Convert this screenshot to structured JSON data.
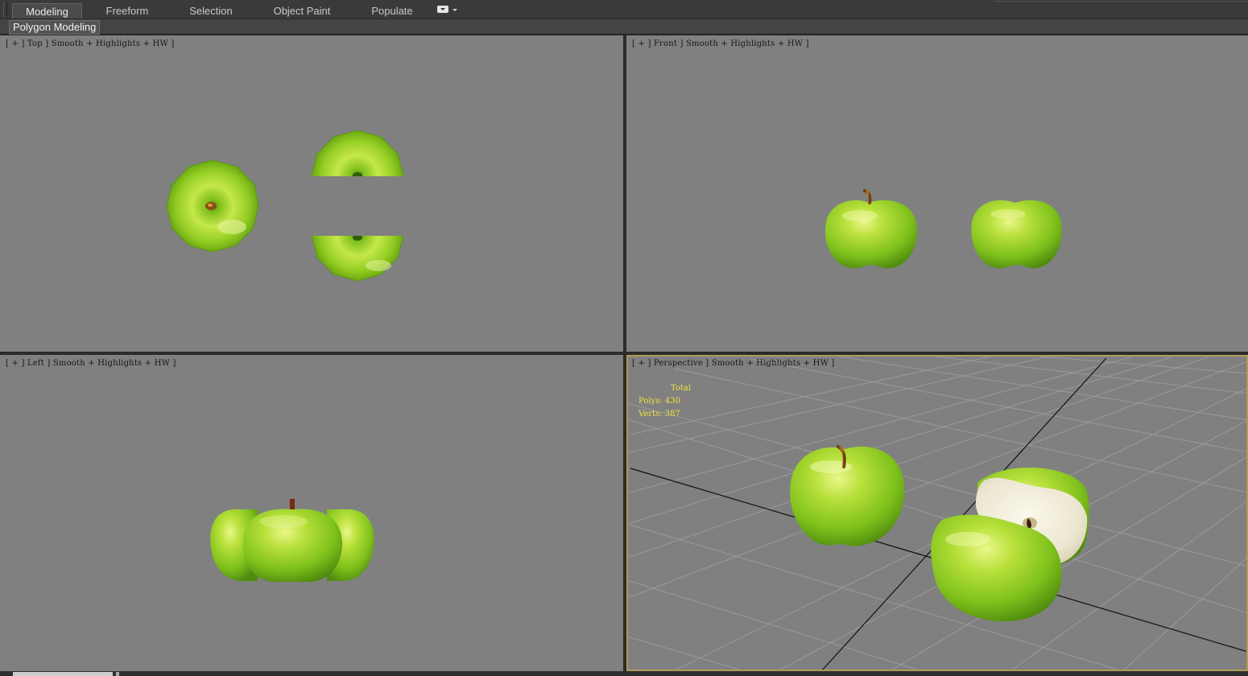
{
  "ribbon": {
    "tabs": [
      {
        "label": "Modeling",
        "active": true
      },
      {
        "label": "Freeform",
        "active": false
      },
      {
        "label": "Selection",
        "active": false
      },
      {
        "label": "Object Paint",
        "active": false
      },
      {
        "label": "Populate",
        "active": false
      }
    ],
    "options_icon": "ribbon-options-icon",
    "panel_label": "Polygon Modeling"
  },
  "viewports": {
    "top": {
      "label": "[ + ] Top ] Smooth + Highlights + HW ]"
    },
    "front": {
      "label": "[ + ] Front ] Smooth + Highlights + HW ]"
    },
    "left": {
      "label": "[ + ] Left ] Smooth + Highlights + HW ]"
    },
    "perspective": {
      "label": "[ + ] Perspective ] Smooth + Highlights + HW ]",
      "active": true,
      "stats": {
        "title": "Total",
        "polys": "Polys: 430",
        "verts": "Verts: 387"
      }
    }
  },
  "colors": {
    "viewport_bg": "#808080",
    "active_border": "#b09a57",
    "stats_text": "#f0e23a",
    "apple_green": "#7fc11c"
  }
}
